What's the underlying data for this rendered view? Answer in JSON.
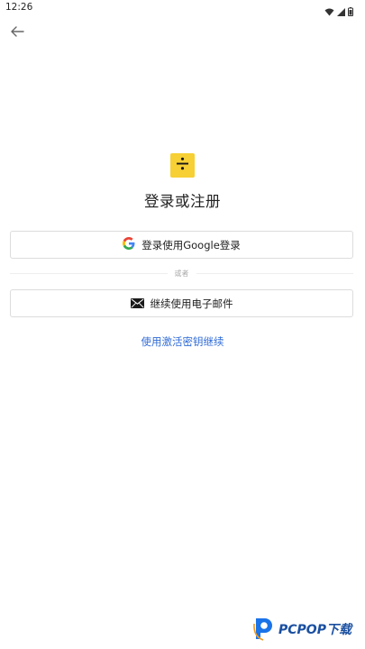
{
  "status_bar": {
    "time": "12:26",
    "icons": [
      "wifi-icon",
      "signal-icon",
      "battery-icon"
    ]
  },
  "nav": {
    "back_icon": "arrow-left-icon"
  },
  "logo": {
    "icon": "division-icon",
    "color": "#F6D034"
  },
  "title": "登录或注册",
  "google_button": {
    "label": "登录使用Google登录",
    "icon": "google-icon"
  },
  "divider_text": "或者",
  "email_button": {
    "label": "继续使用电子邮件",
    "icon": "envelope-icon"
  },
  "activation_link": "使用激活密钥继续",
  "accent_color": "#2F6BD6",
  "watermark": {
    "text": "PCPOP下载"
  }
}
